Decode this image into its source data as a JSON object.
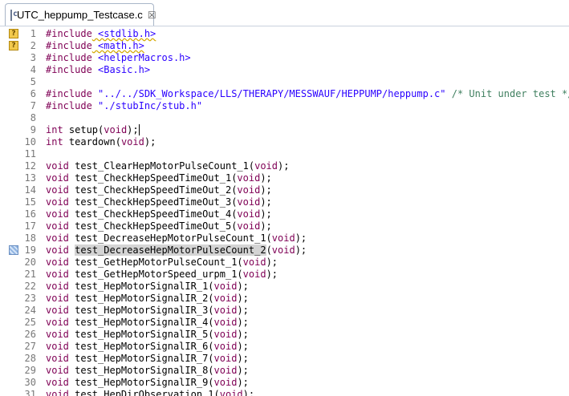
{
  "tab": {
    "title": "UTC_heppump_Testcase.c",
    "close": "☒"
  },
  "lines": [
    {
      "n": "1",
      "marker": "warn",
      "t": [
        [
          "kw",
          "#include"
        ],
        [
          "",
          ""
        ],
        [
          "str",
          " <stdlib.h>",
          "warn"
        ]
      ]
    },
    {
      "n": "2",
      "marker": "warn",
      "t": [
        [
          "kw",
          "#include"
        ],
        [
          "str",
          " <math.h>",
          "warn"
        ]
      ]
    },
    {
      "n": "3",
      "t": [
        [
          "kw",
          "#include"
        ],
        [
          "str",
          " <helperMacros.h>"
        ]
      ]
    },
    {
      "n": "4",
      "t": [
        [
          "kw",
          "#include"
        ],
        [
          "str",
          " <Basic.h>"
        ]
      ]
    },
    {
      "n": "5",
      "t": []
    },
    {
      "n": "6",
      "t": [
        [
          "kw",
          "#include"
        ],
        [
          "str",
          " \"../../SDK_Workspace/LLS/THERAPY/MESSWAUF/HEPPUMP/heppump.c\""
        ],
        [
          "cm",
          " /* Unit under test */"
        ]
      ]
    },
    {
      "n": "7",
      "t": [
        [
          "kw",
          "#include"
        ],
        [
          "str",
          " \"./stubInc/stub.h\""
        ]
      ]
    },
    {
      "n": "8",
      "t": []
    },
    {
      "n": "9",
      "t": [
        [
          "kw",
          "int"
        ],
        [
          "",
          " setup("
        ],
        [
          "kw",
          "void"
        ],
        [
          "caret",
          ");"
        ]
      ]
    },
    {
      "n": "10",
      "t": [
        [
          "kw",
          "int"
        ],
        [
          "",
          " teardown("
        ],
        [
          "kw",
          "void"
        ],
        [
          "",
          ");"
        ]
      ]
    },
    {
      "n": "11",
      "t": []
    },
    {
      "n": "12",
      "t": [
        [
          "kw",
          "void"
        ],
        [
          "",
          " test_ClearHepMotorPulseCount_1("
        ],
        [
          "kw",
          "void"
        ],
        [
          "",
          ");"
        ]
      ]
    },
    {
      "n": "13",
      "t": [
        [
          "kw",
          "void"
        ],
        [
          "",
          " test_CheckHepSpeedTimeOut_1("
        ],
        [
          "kw",
          "void"
        ],
        [
          "",
          ");"
        ]
      ]
    },
    {
      "n": "14",
      "t": [
        [
          "kw",
          "void"
        ],
        [
          "",
          " test_CheckHepSpeedTimeOut_2("
        ],
        [
          "kw",
          "void"
        ],
        [
          "",
          ");"
        ]
      ]
    },
    {
      "n": "15",
      "t": [
        [
          "kw",
          "void"
        ],
        [
          "",
          " test_CheckHepSpeedTimeOut_3("
        ],
        [
          "kw",
          "void"
        ],
        [
          "",
          ");"
        ]
      ]
    },
    {
      "n": "16",
      "t": [
        [
          "kw",
          "void"
        ],
        [
          "",
          " test_CheckHepSpeedTimeOut_4("
        ],
        [
          "kw",
          "void"
        ],
        [
          "",
          ");"
        ]
      ]
    },
    {
      "n": "17",
      "t": [
        [
          "kw",
          "void"
        ],
        [
          "",
          " test_CheckHepSpeedTimeOut_5("
        ],
        [
          "kw",
          "void"
        ],
        [
          "",
          ");"
        ]
      ]
    },
    {
      "n": "18",
      "t": [
        [
          "kw",
          "void"
        ],
        [
          "",
          " test_DecreaseHepMotorPulseCount_1("
        ],
        [
          "kw",
          "void"
        ],
        [
          "",
          ");"
        ]
      ]
    },
    {
      "n": "19",
      "marker": "occ",
      "t": [
        [
          "kw",
          "void"
        ],
        [
          "",
          " "
        ],
        [
          "hl",
          "test_DecreaseHepMotorPulseCount_2"
        ],
        [
          "",
          "("
        ],
        [
          "kw",
          "void"
        ],
        [
          "",
          ");"
        ]
      ]
    },
    {
      "n": "20",
      "t": [
        [
          "kw",
          "void"
        ],
        [
          "",
          " test_GetHepMotorPulseCount_1("
        ],
        [
          "kw",
          "void"
        ],
        [
          "",
          ");"
        ]
      ]
    },
    {
      "n": "21",
      "t": [
        [
          "kw",
          "void"
        ],
        [
          "",
          " test_GetHepMotorSpeed_urpm_1("
        ],
        [
          "kw",
          "void"
        ],
        [
          "",
          ");"
        ]
      ]
    },
    {
      "n": "22",
      "t": [
        [
          "kw",
          "void"
        ],
        [
          "",
          " test_HepMotorSignalIR_1("
        ],
        [
          "kw",
          "void"
        ],
        [
          "",
          ");"
        ]
      ]
    },
    {
      "n": "23",
      "t": [
        [
          "kw",
          "void"
        ],
        [
          "",
          " test_HepMotorSignalIR_2("
        ],
        [
          "kw",
          "void"
        ],
        [
          "",
          ");"
        ]
      ]
    },
    {
      "n": "24",
      "t": [
        [
          "kw",
          "void"
        ],
        [
          "",
          " test_HepMotorSignalIR_3("
        ],
        [
          "kw",
          "void"
        ],
        [
          "",
          ");"
        ]
      ]
    },
    {
      "n": "25",
      "t": [
        [
          "kw",
          "void"
        ],
        [
          "",
          " test_HepMotorSignalIR_4("
        ],
        [
          "kw",
          "void"
        ],
        [
          "",
          ");"
        ]
      ]
    },
    {
      "n": "26",
      "t": [
        [
          "kw",
          "void"
        ],
        [
          "",
          " test_HepMotorSignalIR_5("
        ],
        [
          "kw",
          "void"
        ],
        [
          "",
          ");"
        ]
      ]
    },
    {
      "n": "27",
      "t": [
        [
          "kw",
          "void"
        ],
        [
          "",
          " test_HepMotorSignalIR_6("
        ],
        [
          "kw",
          "void"
        ],
        [
          "",
          ");"
        ]
      ]
    },
    {
      "n": "28",
      "t": [
        [
          "kw",
          "void"
        ],
        [
          "",
          " test_HepMotorSignalIR_7("
        ],
        [
          "kw",
          "void"
        ],
        [
          "",
          ");"
        ]
      ]
    },
    {
      "n": "29",
      "t": [
        [
          "kw",
          "void"
        ],
        [
          "",
          " test_HepMotorSignalIR_8("
        ],
        [
          "kw",
          "void"
        ],
        [
          "",
          ");"
        ]
      ]
    },
    {
      "n": "30",
      "t": [
        [
          "kw",
          "void"
        ],
        [
          "",
          " test_HepMotorSignalIR_9("
        ],
        [
          "kw",
          "void"
        ],
        [
          "",
          ");"
        ]
      ]
    },
    {
      "n": "31",
      "t": [
        [
          "kw",
          "void"
        ],
        [
          "",
          " test_HepDirObservation_1("
        ],
        [
          "kw",
          "void"
        ],
        [
          "",
          ");"
        ]
      ]
    }
  ],
  "colors": {
    "keyword": "#7f0055",
    "string": "#2a00ff",
    "comment": "#3f7f5f",
    "line_number": "#787878"
  }
}
